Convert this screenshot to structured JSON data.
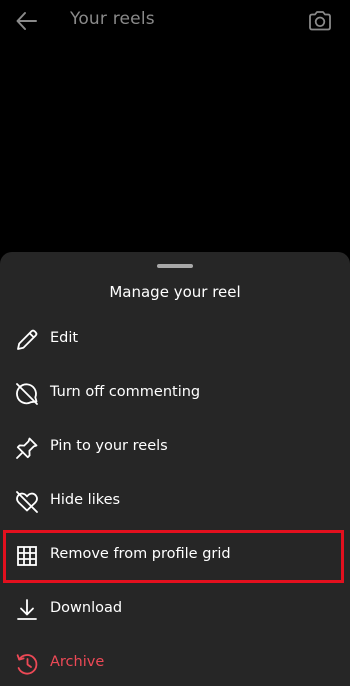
{
  "header": {
    "title": "Your reels",
    "back_icon": "arrow-left-icon",
    "camera_icon": "camera-icon"
  },
  "sheet": {
    "title": "Manage your reel",
    "items": [
      {
        "label": "Edit",
        "icon": "pencil-icon"
      },
      {
        "label": "Turn off commenting",
        "icon": "comment-off-icon"
      },
      {
        "label": "Pin to your reels",
        "icon": "pin-icon"
      },
      {
        "label": "Hide likes",
        "icon": "heart-off-icon"
      },
      {
        "label": "Remove from profile grid",
        "icon": "grid-icon",
        "highlighted": true
      },
      {
        "label": "Download",
        "icon": "download-icon"
      },
      {
        "label": "Archive",
        "icon": "archive-icon",
        "color": "#ed4956"
      }
    ]
  },
  "colors": {
    "background": "#000000",
    "sheet": "#262626",
    "highlight_border": "#e3101e",
    "danger_text": "#ed4956",
    "dim_text": "#8a8a8a"
  }
}
